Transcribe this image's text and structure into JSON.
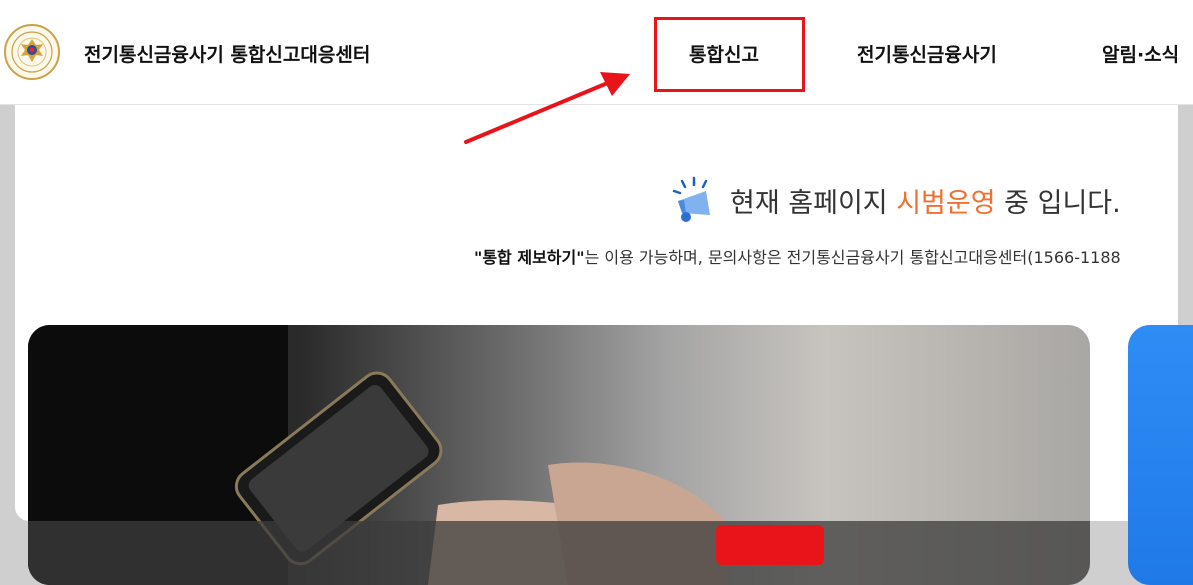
{
  "header": {
    "site_title": "전기통신금융사기 통합신고대응센터",
    "nav": [
      {
        "label": "통합신고"
      },
      {
        "label": "전기통신금융사기"
      },
      {
        "label": "알림·소식"
      }
    ]
  },
  "notice": {
    "prefix": "현재 홈페이지 ",
    "highlight": "시범운영",
    "suffix": " 중 입니다.",
    "highlight_color": "#f07030",
    "icon": "megaphone-icon"
  },
  "subnotice": {
    "bold": "\"통합 제보하기\"",
    "text": "는 이용 가능하며, 문의사항은 전기통신금융사기 통합신고대응센터(1566-1188"
  },
  "annotation": {
    "box_color": "#e8141a",
    "arrow_color": "#e8141a"
  }
}
